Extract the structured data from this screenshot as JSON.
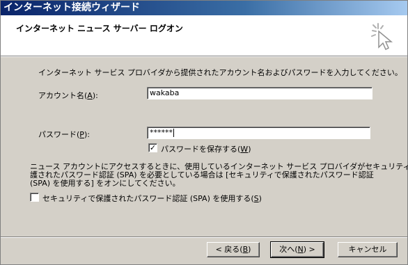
{
  "window": {
    "title": "インターネット接続ウィザード"
  },
  "header": {
    "title": "インターネット ニュース サーバー ログオン"
  },
  "intro": "インターネット サービス プロバイダから提供されたアカウント名およびパスワードを入力してください。",
  "account": {
    "label_prefix": "アカウント名(",
    "mnemonic": "A",
    "label_suffix": "):",
    "value": "wakaba"
  },
  "password": {
    "label_prefix": "パスワード(",
    "mnemonic": "P",
    "label_suffix": "):",
    "value": "******"
  },
  "save_password": {
    "label_prefix": "パスワードを保存する(",
    "mnemonic": "W",
    "label_suffix": ")",
    "checked": true,
    "mark": "✓"
  },
  "spa_note": {
    "lines": [
      "ニュース アカウントにアクセスするときに、使用しているインターネット サービス プロバイダがセキュリティで保",
      "護されたパスワード認証 (SPA) を必要としている場合は [セキュリティで保護されたパスワード認証",
      "(SPA) を使用する] をオンにしてください。"
    ]
  },
  "spa_checkbox": {
    "label_prefix": "セキュリティで保護されたパスワード認証 (SPA) を使用する(",
    "mnemonic": "S",
    "label_suffix": ")",
    "checked": false
  },
  "buttons": {
    "back": {
      "prefix": "< 戻る(",
      "mnemonic": "B",
      "suffix": ")"
    },
    "next": {
      "prefix": "次へ(",
      "mnemonic": "N",
      "suffix": ") >"
    },
    "cancel": "キャンセル"
  }
}
